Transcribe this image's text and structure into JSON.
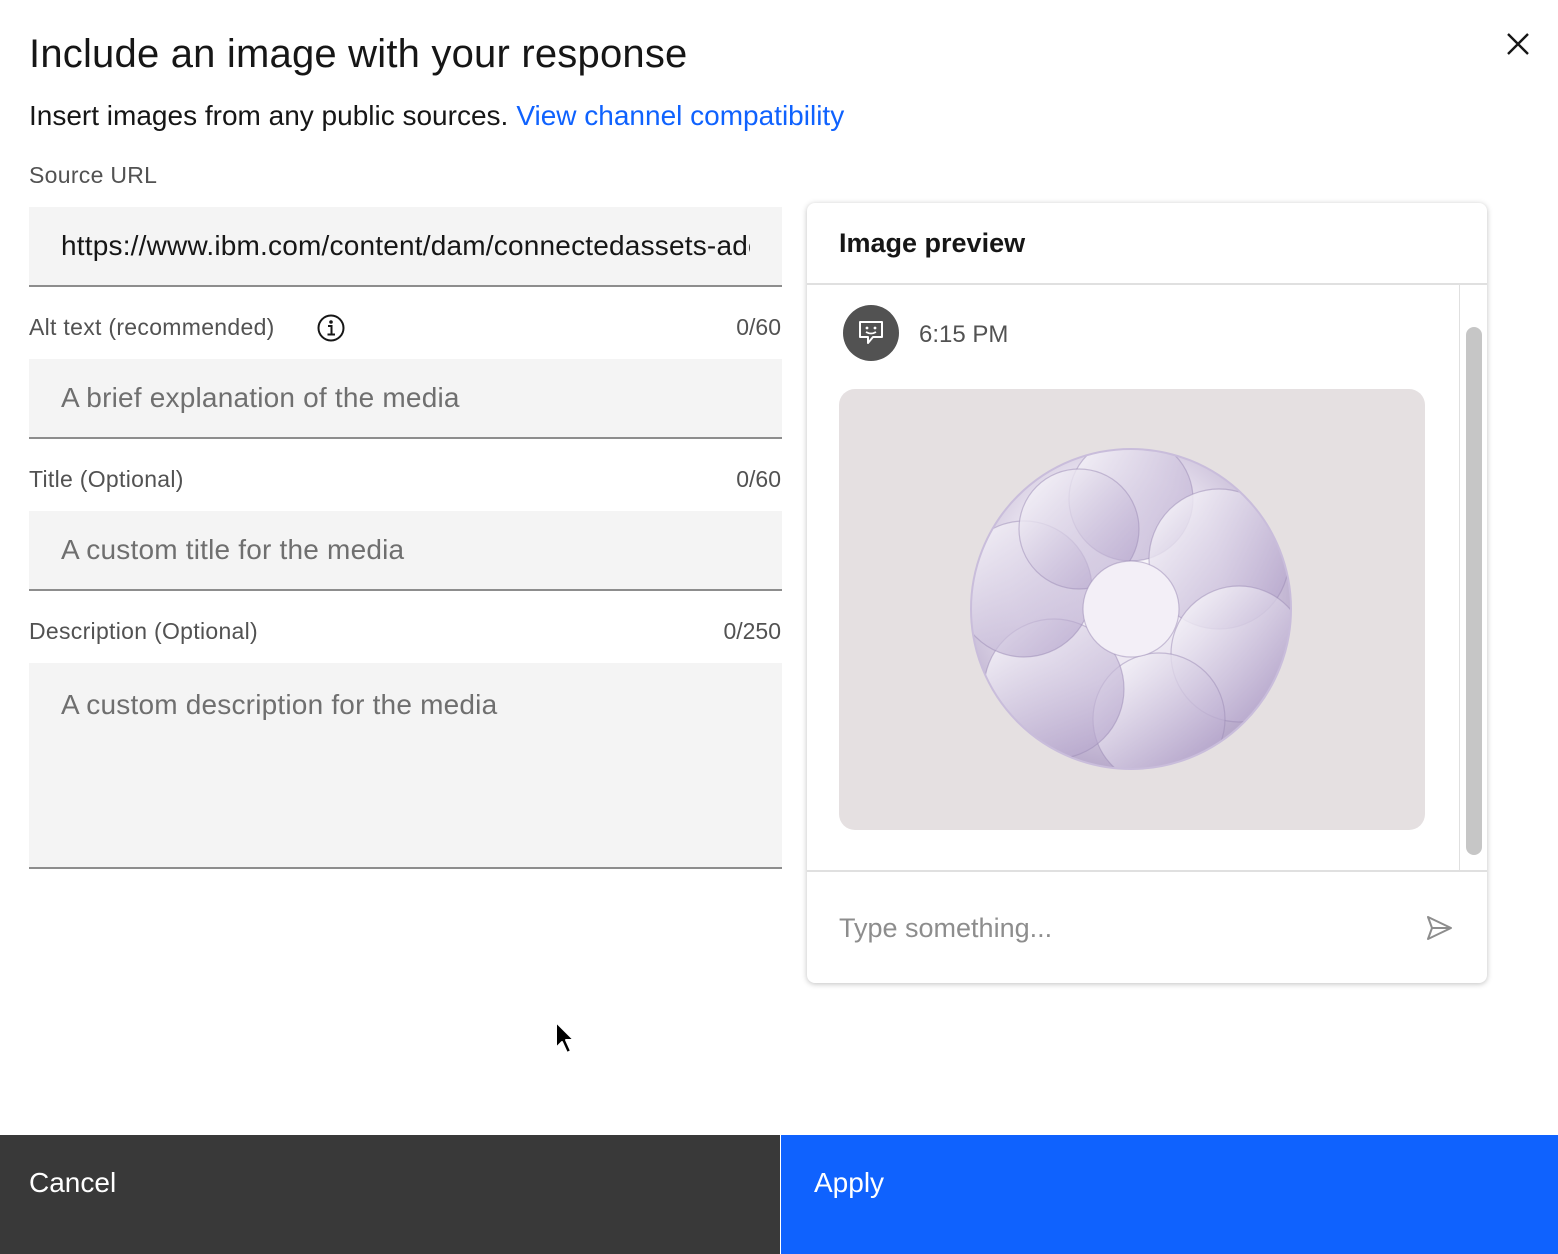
{
  "modal": {
    "title": "Include an image with your response",
    "subtitle": "Insert images from any public sources.",
    "compat_link": "View channel compatibility",
    "close_icon": "close-icon"
  },
  "form": {
    "source_url": {
      "label": "Source URL",
      "value": "https://www.ibm.com/content/dam/connectedassets-adobe-cms/worldwide-content/creative-assets/s-migr/ul/g/e0/4a/image.png"
    },
    "alt_text": {
      "label": "Alt text (recommended)",
      "counter": "0/60",
      "placeholder": "A brief explanation of the media",
      "info_icon": "information-icon"
    },
    "title": {
      "label": "Title (Optional)",
      "counter": "0/60",
      "placeholder": "A custom title for the media"
    },
    "description": {
      "label": "Description (Optional)",
      "counter": "0/250",
      "placeholder": "A custom description for the media"
    }
  },
  "preview": {
    "title": "Image preview",
    "timestamp": "6:15 PM",
    "avatar_icon": "bot-chat-icon",
    "input_placeholder": "Type something...",
    "send_icon": "send-icon",
    "colors": {
      "image_bg": "#e5e0e1",
      "avatar_bg": "#525252"
    }
  },
  "footer": {
    "cancel_label": "Cancel",
    "apply_label": "Apply",
    "colors": {
      "cancel_bg": "#393939",
      "apply_bg": "#0f62fe"
    }
  }
}
